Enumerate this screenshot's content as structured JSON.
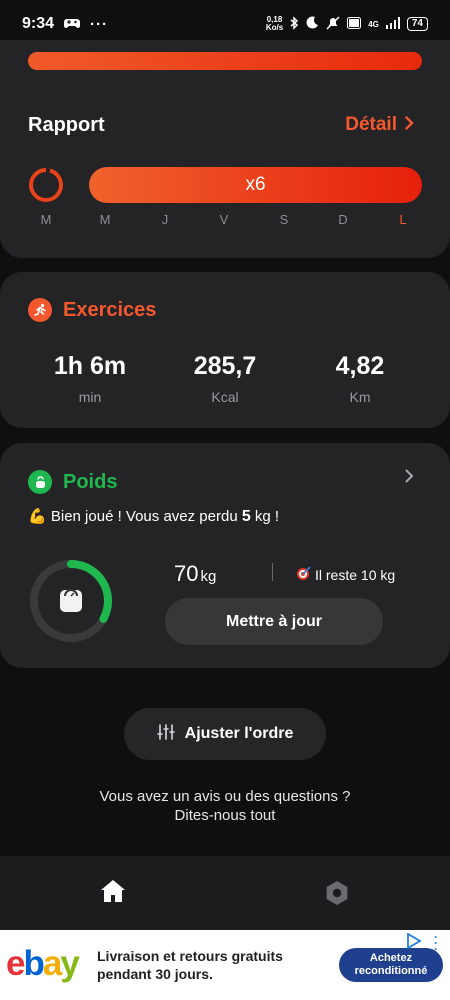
{
  "status_bar": {
    "time": "9:34",
    "more": "···",
    "net_speed_value": "0,18",
    "net_speed_unit": "Ko/s",
    "network": "4G",
    "battery": "74"
  },
  "report": {
    "title": "Rapport",
    "detail_label": "Détail",
    "week_label": "x6",
    "days": [
      "M",
      "M",
      "J",
      "V",
      "S",
      "D",
      "L"
    ],
    "active_day_index": 6
  },
  "exercises": {
    "title": "Exercices",
    "stats": [
      {
        "value": "1h 6m",
        "unit": "min"
      },
      {
        "value": "285,7",
        "unit": "Kcal"
      },
      {
        "value": "4,82",
        "unit": "Km"
      }
    ]
  },
  "weight": {
    "title": "Poids",
    "message_emoji": "💪",
    "message_prefix": "Bien joué ! Vous avez perdu",
    "message_amount": "5",
    "message_suffix": "kg !",
    "current_value": "70",
    "current_unit": "kg",
    "remaining_label": "Il reste 10 kg",
    "progress_fraction": 0.33,
    "update_button": "Mettre à jour"
  },
  "adjust_button": "Ajuster l'ordre",
  "feedback": {
    "line1": "Vous avez un avis ou des questions ?",
    "line2": "Dites-nous tout"
  },
  "ad": {
    "brand_letters": [
      "e",
      "b",
      "a",
      "y"
    ],
    "brand_colors": [
      "#e53238",
      "#0064d2",
      "#f5af02",
      "#86b817"
    ],
    "text": "Livraison et retours gratuits pendant 30 jours.",
    "button": "Achetez reconditionné"
  },
  "colors": {
    "accent_orange": "#f5582e",
    "weight_green": "#1fb84e"
  }
}
